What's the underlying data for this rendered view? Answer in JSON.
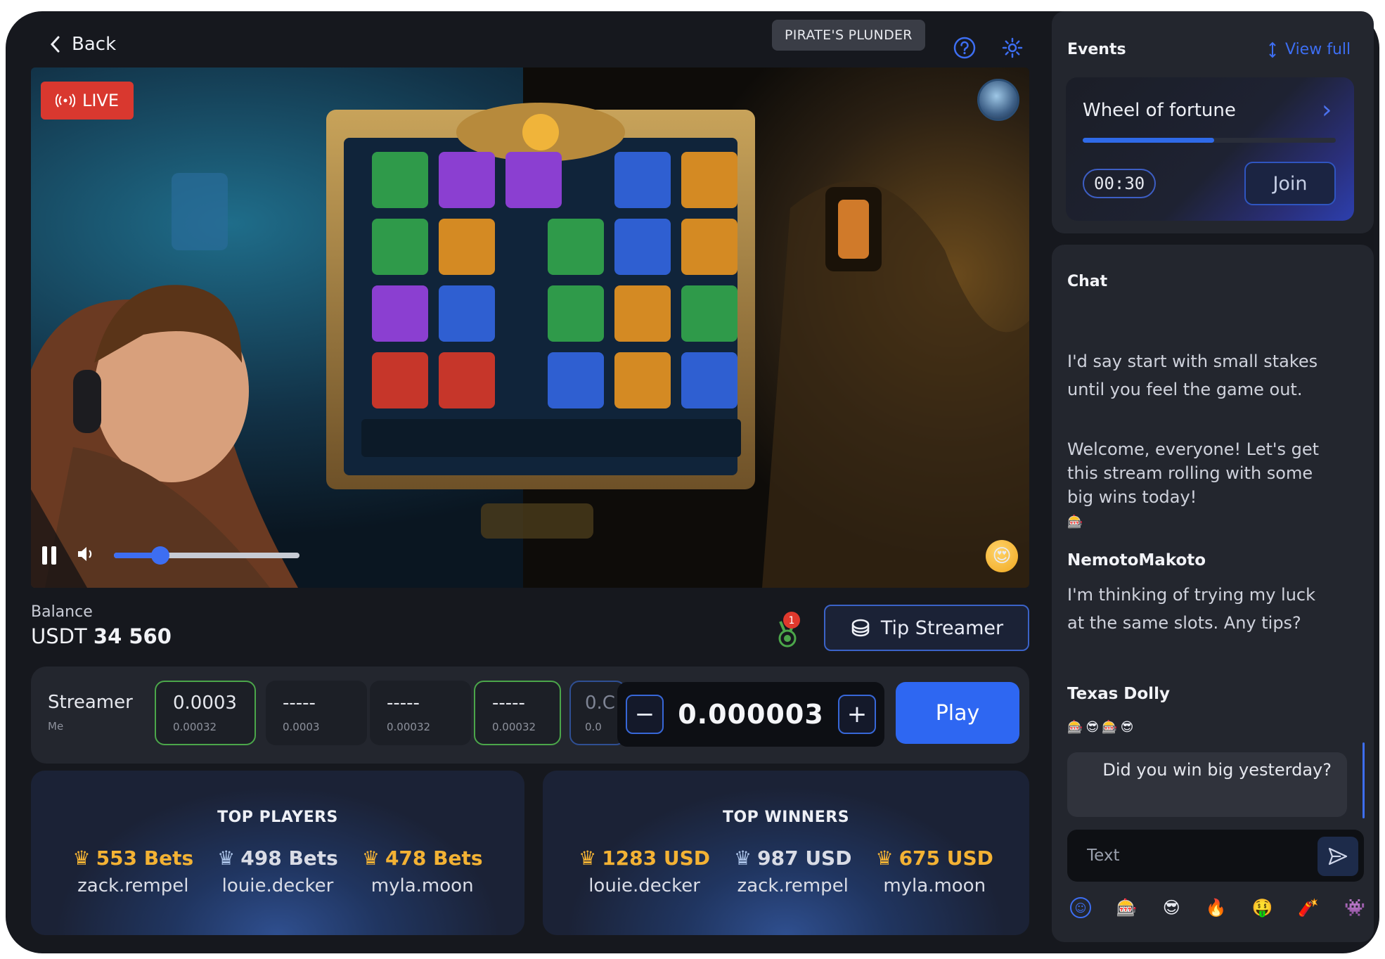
{
  "header": {
    "back_label": "Back",
    "game_name": "PIRATE'S PLUNDER"
  },
  "video": {
    "live_label": "LIVE",
    "volume_level": 0.25
  },
  "balance": {
    "label": "Balance",
    "currency": "USDT",
    "amount": "34 560",
    "medal_count": "1"
  },
  "tip": {
    "label": "Tip Streamer"
  },
  "bet": {
    "label": "Streamer",
    "sublabel": "Me",
    "chips": [
      {
        "value": "0.0003",
        "sub": "0.00032"
      },
      {
        "value": "-----",
        "sub": "0.0003"
      },
      {
        "value": "-----",
        "sub": "0.00032"
      },
      {
        "value": "-----",
        "sub": "0.00032"
      },
      {
        "value": "0.C",
        "sub": "0.0"
      }
    ],
    "amount": "0.000003",
    "minus": "−",
    "plus": "+",
    "play_label": "Play"
  },
  "top_players": {
    "title": "TOP PLAYERS",
    "entries": [
      {
        "amount": "553 Bets",
        "name": "zack.rempel"
      },
      {
        "amount": "498 Bets",
        "name": "louie.decker"
      },
      {
        "amount": "478 Bets",
        "name": "myla.moon"
      }
    ]
  },
  "top_winners": {
    "title": "TOP WINNERS",
    "entries": [
      {
        "amount": "1283 USD",
        "name": "louie.decker"
      },
      {
        "amount": "987 USD",
        "name": "zack.rempel"
      },
      {
        "amount": "675 USD",
        "name": "myla.moon"
      }
    ]
  },
  "events": {
    "title": "Events",
    "view_full": "View full",
    "card_title": "Wheel of fortune",
    "timer": "00:30",
    "join_label": "Join",
    "progress": 0.52
  },
  "chat": {
    "title": "Chat",
    "messages": [
      {
        "text": "I'd say start with small stakes until you feel the game out."
      },
      {
        "text": "Welcome, everyone! Let's get this stream rolling with some big wins today!"
      },
      {
        "user": "NemotoMakoto",
        "text": "I'm thinking of trying my luck at the same slots. Any tips?"
      },
      {
        "user": "Texas Dolly"
      }
    ],
    "my_message": "Did you win big yesterday?",
    "input_placeholder": "Text"
  },
  "colors": {
    "accent": "#2e67f2",
    "live": "#d9382f",
    "gold": "#f3b234",
    "selected_chip": "#4ba64a"
  }
}
